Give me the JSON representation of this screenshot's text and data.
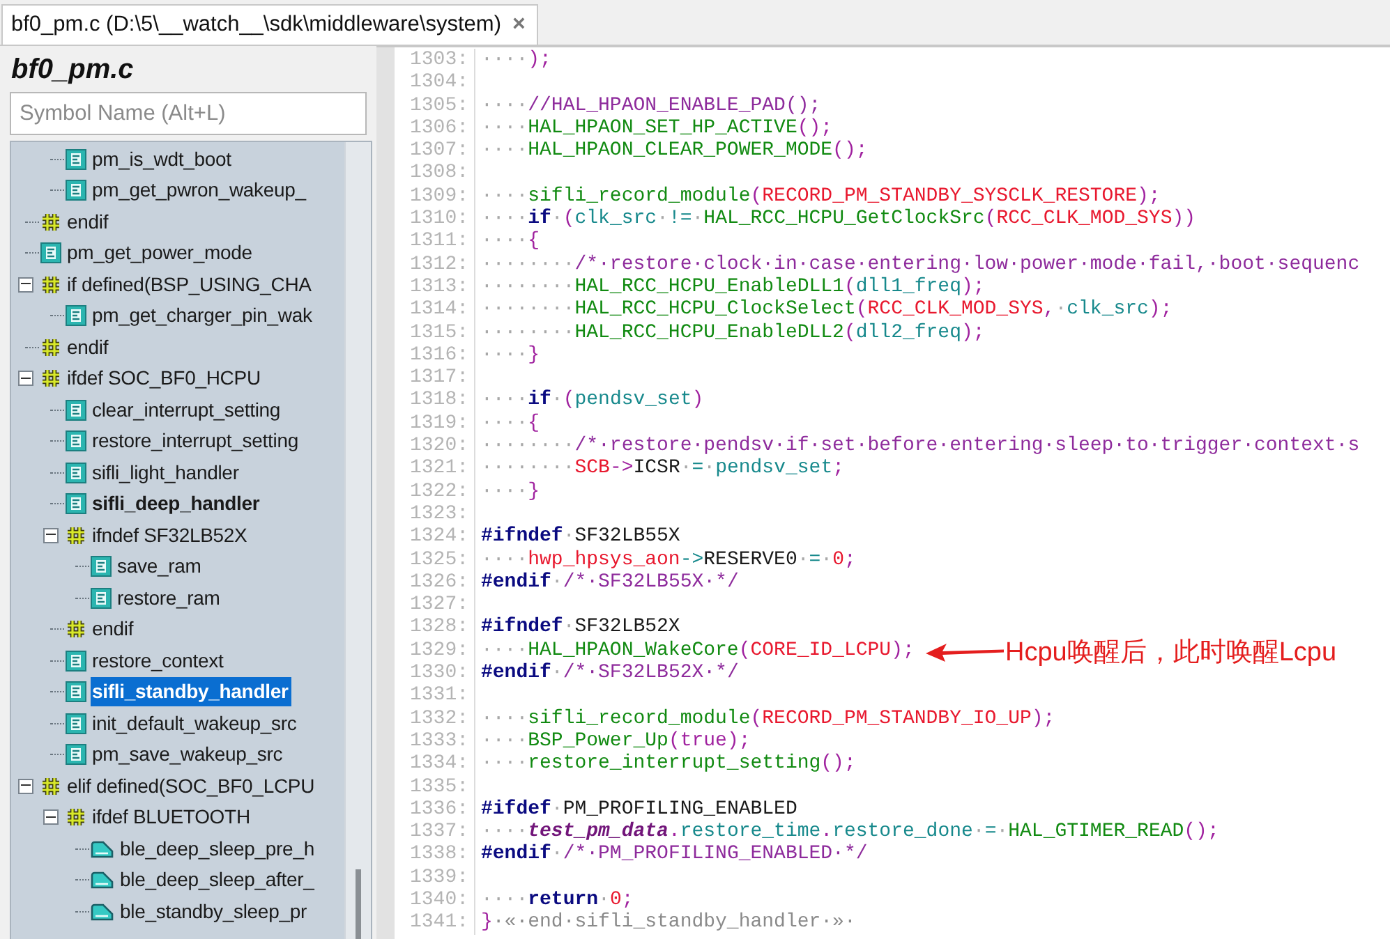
{
  "tab": {
    "title": "bf0_pm.c (D:\\5\\__watch__\\sdk\\middleware\\system)",
    "close": "×",
    "selected": true
  },
  "outline": {
    "title": "bf0_pm.c",
    "search": {
      "placeholder": "Symbol Name (Alt+L)"
    },
    "tree": [
      {
        "kind": "continuation",
        "children": [
          {
            "kind": "function",
            "label": "pm_is_wdt_boot",
            "bold": false,
            "selected": false
          },
          {
            "kind": "function",
            "label": "pm_get_pwron_wakeup_",
            "bold": false,
            "selected": false
          }
        ]
      },
      {
        "kind": "directive",
        "label": "endif",
        "bold": false,
        "selected": false
      },
      {
        "kind": "function",
        "label": "pm_get_power_mode",
        "bold": false,
        "selected": false
      },
      {
        "kind": "directive",
        "label": "if defined(BSP_USING_CHA",
        "bold": false,
        "selected": false,
        "expanded": true,
        "children": [
          {
            "kind": "function",
            "label": "pm_get_charger_pin_wak",
            "bold": false,
            "selected": false
          }
        ]
      },
      {
        "kind": "directive",
        "label": "endif",
        "bold": false,
        "selected": false
      },
      {
        "kind": "directive",
        "label": "ifdef SOC_BF0_HCPU",
        "bold": false,
        "selected": false,
        "expanded": true,
        "children": [
          {
            "kind": "function",
            "label": "clear_interrupt_setting",
            "bold": false,
            "selected": false
          },
          {
            "kind": "function",
            "label": "restore_interrupt_setting",
            "bold": false,
            "selected": false
          },
          {
            "kind": "function",
            "label": "sifli_light_handler",
            "bold": false,
            "selected": false
          },
          {
            "kind": "function",
            "label": "sifli_deep_handler",
            "bold": true,
            "selected": false
          },
          {
            "kind": "directive",
            "label": "ifndef SF32LB52X",
            "bold": false,
            "selected": false,
            "expanded": true,
            "children": [
              {
                "kind": "function",
                "label": "save_ram",
                "bold": false,
                "selected": false
              },
              {
                "kind": "function",
                "label": "restore_ram",
                "bold": false,
                "selected": false
              }
            ]
          },
          {
            "kind": "directive",
            "label": "endif",
            "bold": false,
            "selected": false
          },
          {
            "kind": "function",
            "label": "restore_context",
            "bold": false,
            "selected": false
          },
          {
            "kind": "function",
            "label": "sifli_standby_handler",
            "bold": true,
            "selected": true
          },
          {
            "kind": "function",
            "label": "init_default_wakeup_src",
            "bold": false,
            "selected": false
          },
          {
            "kind": "function",
            "label": "pm_save_wakeup_src",
            "bold": false,
            "selected": false
          }
        ]
      },
      {
        "kind": "directive",
        "label": "elif defined(SOC_BF0_LCPU",
        "bold": false,
        "selected": false,
        "expanded": true,
        "children": [
          {
            "kind": "directive",
            "label": "ifdef BLUETOOTH",
            "bold": false,
            "selected": false,
            "expanded": true,
            "children": [
              {
                "kind": "prototype",
                "label": "ble_deep_sleep_pre_h",
                "bold": false,
                "selected": false
              },
              {
                "kind": "prototype",
                "label": "ble_deep_sleep_after_",
                "bold": false,
                "selected": false
              },
              {
                "kind": "prototype",
                "label": "ble_standby_sleep_pr",
                "bold": false,
                "selected": false
              }
            ]
          }
        ]
      }
    ]
  },
  "code": {
    "lines": [
      {
        "number": "1303:",
        "tokens": [
          {
            "kind": "ws",
            "text": "····"
          },
          {
            "kind": "punct",
            "text": ");"
          }
        ]
      },
      {
        "number": "1304:"
      },
      {
        "number": "1305:",
        "tokens": [
          {
            "kind": "ws",
            "text": "····"
          },
          {
            "kind": "comment",
            "text": "//HAL_HPAON_ENABLE_PAD();"
          }
        ]
      },
      {
        "number": "1306:",
        "tokens": [
          {
            "kind": "ws",
            "text": "····"
          },
          {
            "kind": "fn",
            "text": "HAL_HPAON_SET_HP_ACTIVE"
          },
          {
            "kind": "punct",
            "text": "();"
          }
        ]
      },
      {
        "number": "1307:",
        "tokens": [
          {
            "kind": "ws",
            "text": "····"
          },
          {
            "kind": "fn",
            "text": "HAL_HPAON_CLEAR_POWER_MODE"
          },
          {
            "kind": "punct",
            "text": "();"
          }
        ]
      },
      {
        "number": "1308:"
      },
      {
        "number": "1309:",
        "tokens": [
          {
            "kind": "ws",
            "text": "····"
          },
          {
            "kind": "fn",
            "text": "sifli_record_module"
          },
          {
            "kind": "punct",
            "text": "("
          },
          {
            "kind": "const",
            "text": "RECORD_PM_STANDBY_SYSCLK_RESTORE"
          },
          {
            "kind": "punct",
            "text": ");"
          }
        ]
      },
      {
        "number": "1310:",
        "tokens": [
          {
            "kind": "ws",
            "text": "····"
          },
          {
            "kind": "kw",
            "text": "if"
          },
          {
            "kind": "ws",
            "text": "·"
          },
          {
            "kind": "punct",
            "text": "("
          },
          {
            "kind": "var",
            "text": "clk_src"
          },
          {
            "kind": "ws",
            "text": "·"
          },
          {
            "kind": "op",
            "text": "!="
          },
          {
            "kind": "ws",
            "text": "·"
          },
          {
            "kind": "fn",
            "text": "HAL_RCC_HCPU_GetClockSrc"
          },
          {
            "kind": "punct",
            "text": "("
          },
          {
            "kind": "const",
            "text": "RCC_CLK_MOD_SYS"
          },
          {
            "kind": "punct",
            "text": "))"
          }
        ]
      },
      {
        "number": "1311:",
        "tokens": [
          {
            "kind": "ws",
            "text": "····"
          },
          {
            "kind": "punct",
            "text": "{"
          }
        ]
      },
      {
        "number": "1312:",
        "tokens": [
          {
            "kind": "ws",
            "text": "········"
          },
          {
            "kind": "comment",
            "text": "/*·restore·clock·in·case·entering·low·power·mode·fail,·boot·sequenc"
          }
        ]
      },
      {
        "number": "1313:",
        "tokens": [
          {
            "kind": "ws",
            "text": "········"
          },
          {
            "kind": "fn",
            "text": "HAL_RCC_HCPU_EnableDLL1"
          },
          {
            "kind": "punct",
            "text": "("
          },
          {
            "kind": "var",
            "text": "dll1_freq"
          },
          {
            "kind": "punct",
            "text": ");"
          }
        ]
      },
      {
        "number": "1314:",
        "tokens": [
          {
            "kind": "ws",
            "text": "········"
          },
          {
            "kind": "fn",
            "text": "HAL_RCC_HCPU_ClockSelect"
          },
          {
            "kind": "punct",
            "text": "("
          },
          {
            "kind": "const",
            "text": "RCC_CLK_MOD_SYS"
          },
          {
            "kind": "punct",
            "text": ","
          },
          {
            "kind": "ws",
            "text": "·"
          },
          {
            "kind": "var",
            "text": "clk_src"
          },
          {
            "kind": "punct",
            "text": ");"
          }
        ]
      },
      {
        "number": "1315:",
        "tokens": [
          {
            "kind": "ws",
            "text": "········"
          },
          {
            "kind": "fn",
            "text": "HAL_RCC_HCPU_EnableDLL2"
          },
          {
            "kind": "punct",
            "text": "("
          },
          {
            "kind": "var",
            "text": "dll2_freq"
          },
          {
            "kind": "punct",
            "text": ");"
          }
        ]
      },
      {
        "number": "1316:",
        "tokens": [
          {
            "kind": "ws",
            "text": "····"
          },
          {
            "kind": "punct",
            "text": "}"
          }
        ]
      },
      {
        "number": "1317:"
      },
      {
        "number": "1318:",
        "tokens": [
          {
            "kind": "ws",
            "text": "····"
          },
          {
            "kind": "kw",
            "text": "if"
          },
          {
            "kind": "ws",
            "text": "·"
          },
          {
            "kind": "punct",
            "text": "("
          },
          {
            "kind": "var",
            "text": "pendsv_set"
          },
          {
            "kind": "punct",
            "text": ")"
          }
        ]
      },
      {
        "number": "1319:",
        "tokens": [
          {
            "kind": "ws",
            "text": "····"
          },
          {
            "kind": "punct",
            "text": "{"
          }
        ]
      },
      {
        "number": "1320:",
        "tokens": [
          {
            "kind": "ws",
            "text": "········"
          },
          {
            "kind": "comment",
            "text": "/*·restore·pendsv·if·set·before·entering·sleep·to·trigger·context·s"
          }
        ]
      },
      {
        "number": "1321:",
        "tokens": [
          {
            "kind": "ws",
            "text": "········"
          },
          {
            "kind": "const",
            "text": "SCB"
          },
          {
            "kind": "punct",
            "text": "->"
          },
          {
            "kind": "plain",
            "text": "ICSR"
          },
          {
            "kind": "ws",
            "text": "·"
          },
          {
            "kind": "op",
            "text": "="
          },
          {
            "kind": "ws",
            "text": "·"
          },
          {
            "kind": "var",
            "text": "pendsv_set"
          },
          {
            "kind": "punct",
            "text": ";"
          }
        ]
      },
      {
        "number": "1322:",
        "tokens": [
          {
            "kind": "ws",
            "text": "····"
          },
          {
            "kind": "punct",
            "text": "}"
          }
        ]
      },
      {
        "number": "1323:"
      },
      {
        "number": "1324:",
        "tokens": [
          {
            "kind": "kw",
            "text": "#ifndef"
          },
          {
            "kind": "ws",
            "text": "·"
          },
          {
            "kind": "plain",
            "text": "SF32LB55X"
          }
        ]
      },
      {
        "number": "1325:",
        "tokens": [
          {
            "kind": "ws",
            "text": "····"
          },
          {
            "kind": "const",
            "text": "hwp_hpsys_aon"
          },
          {
            "kind": "op",
            "text": "->"
          },
          {
            "kind": "plain",
            "text": "RESERVE0"
          },
          {
            "kind": "ws",
            "text": "·"
          },
          {
            "kind": "op",
            "text": "="
          },
          {
            "kind": "ws",
            "text": "·"
          },
          {
            "kind": "num",
            "text": "0"
          },
          {
            "kind": "punct",
            "text": ";"
          }
        ]
      },
      {
        "number": "1326:",
        "tokens": [
          {
            "kind": "kw",
            "text": "#endif"
          },
          {
            "kind": "ws",
            "text": "·"
          },
          {
            "kind": "comment",
            "text": "/*·SF32LB55X·*/"
          }
        ]
      },
      {
        "number": "1327:"
      },
      {
        "number": "1328:",
        "tokens": [
          {
            "kind": "kw",
            "text": "#ifndef"
          },
          {
            "kind": "ws",
            "text": "·"
          },
          {
            "kind": "plain",
            "text": "SF32LB52X"
          }
        ]
      },
      {
        "number": "1329:",
        "tokens": [
          {
            "kind": "ws",
            "text": "····"
          },
          {
            "kind": "fn",
            "text": "HAL_HPAON_WakeCore"
          },
          {
            "kind": "punct",
            "text": "("
          },
          {
            "kind": "const",
            "text": "CORE_ID_LCPU"
          },
          {
            "kind": "punct",
            "text": ");"
          }
        ]
      },
      {
        "number": "1330:",
        "tokens": [
          {
            "kind": "kw",
            "text": "#endif"
          },
          {
            "kind": "ws",
            "text": "·"
          },
          {
            "kind": "comment",
            "text": "/*·SF32LB52X·*/"
          }
        ]
      },
      {
        "number": "1331:"
      },
      {
        "number": "1332:",
        "tokens": [
          {
            "kind": "ws",
            "text": "····"
          },
          {
            "kind": "fn",
            "text": "sifli_record_module"
          },
          {
            "kind": "punct",
            "text": "("
          },
          {
            "kind": "const",
            "text": "RECORD_PM_STANDBY_IO_UP"
          },
          {
            "kind": "punct",
            "text": ");"
          }
        ]
      },
      {
        "number": "1333:",
        "tokens": [
          {
            "kind": "ws",
            "text": "····"
          },
          {
            "kind": "fn",
            "text": "BSP_Power_Up"
          },
          {
            "kind": "punct",
            "text": "(true);"
          }
        ]
      },
      {
        "number": "1334:",
        "tokens": [
          {
            "kind": "ws",
            "text": "····"
          },
          {
            "kind": "fn",
            "text": "restore_interrupt_setting"
          },
          {
            "kind": "punct",
            "text": "();"
          }
        ]
      },
      {
        "number": "1335:"
      },
      {
        "number": "1336:",
        "tokens": [
          {
            "kind": "kw",
            "text": "#ifdef"
          },
          {
            "kind": "ws",
            "text": "·"
          },
          {
            "kind": "plain",
            "text": "PM_PROFILING_ENABLED"
          }
        ]
      },
      {
        "number": "1337:",
        "tokens": [
          {
            "kind": "ws",
            "text": "····"
          },
          {
            "kind": "italic",
            "text": "test_pm_data"
          },
          {
            "kind": "punct",
            "text": "."
          },
          {
            "kind": "var",
            "text": "restore_time"
          },
          {
            "kind": "punct",
            "text": "."
          },
          {
            "kind": "var",
            "text": "restore_done"
          },
          {
            "kind": "ws",
            "text": "·"
          },
          {
            "kind": "op",
            "text": "="
          },
          {
            "kind": "ws",
            "text": "·"
          },
          {
            "kind": "fn",
            "text": "HAL_GTIMER_READ"
          },
          {
            "kind": "punct",
            "text": "();"
          }
        ]
      },
      {
        "number": "1338:",
        "tokens": [
          {
            "kind": "kw",
            "text": "#endif"
          },
          {
            "kind": "ws",
            "text": "·"
          },
          {
            "kind": "comment",
            "text": "/*·PM_PROFILING_ENABLED·*/"
          }
        ]
      },
      {
        "number": "1339:"
      },
      {
        "number": "1340:",
        "tokens": [
          {
            "kind": "ws",
            "text": "····"
          },
          {
            "kind": "kw",
            "text": "return"
          },
          {
            "kind": "ws",
            "text": "·"
          },
          {
            "kind": "num",
            "text": "0"
          },
          {
            "kind": "punct",
            "text": ";"
          }
        ]
      },
      {
        "number": "1341:",
        "tokens": [
          {
            "kind": "punct",
            "text": "}"
          },
          {
            "kind": "note",
            "text": "·«·end·sifli_standby_handler·»·"
          }
        ]
      }
    ]
  },
  "annotation": {
    "text": "Hcpu唤醒后，此时唤醒Lcpu"
  }
}
